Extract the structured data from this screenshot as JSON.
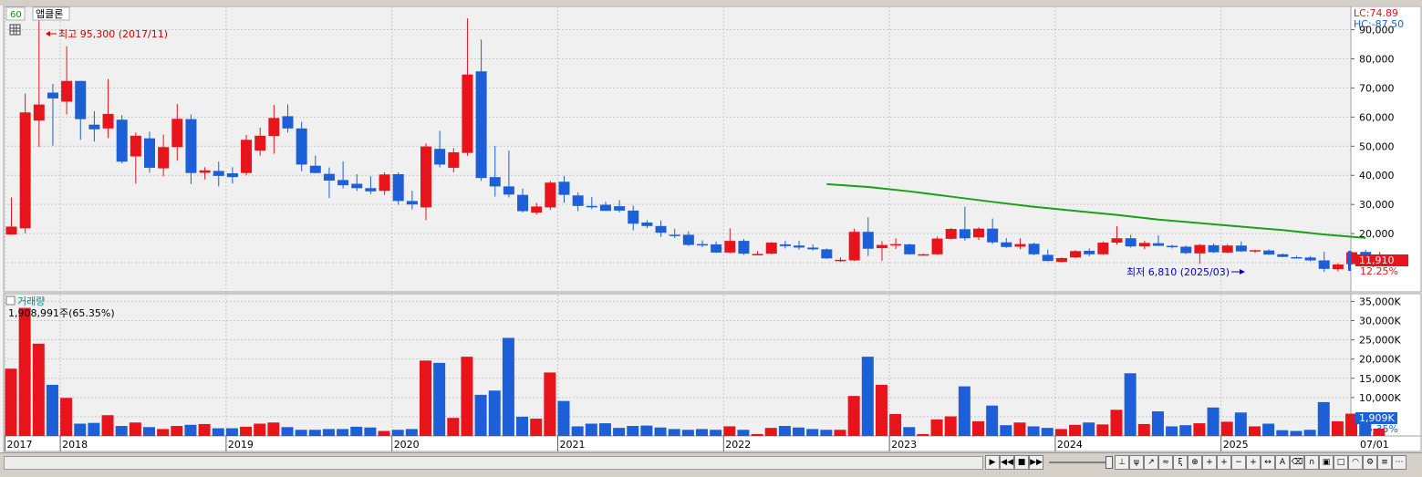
{
  "header": {
    "period_label": "60",
    "stock_name": "앱클론"
  },
  "price_panel": {
    "high_annotation": "최고 95,300 (2017/11)",
    "low_annotation": "최저 6,810 (2025/03)",
    "lc_label": "LC:74.89",
    "hc_label": "HC:-87.50",
    "current_price_label": "11,910",
    "current_pct_label": "12.25%",
    "y_ticks": [
      "90,000",
      "80,000",
      "70,000",
      "60,000",
      "50,000",
      "40,000",
      "30,000",
      "20,000",
      "10,000"
    ]
  },
  "volume_panel": {
    "title": "거래량",
    "summary": "1,908,991주(65.35%)",
    "current_volume_label": "1,909K",
    "current_pct_label": "65.35%",
    "y_ticks": [
      "35,000K",
      "30,000K",
      "25,000K",
      "20,000K",
      "15,000K",
      "10,000K",
      "5,000K"
    ]
  },
  "x_axis": {
    "labels": [
      "2017",
      "2018",
      "2019",
      "2020",
      "2021",
      "2022",
      "2023",
      "2024",
      "2025"
    ],
    "right_label": "07/01"
  },
  "colors": {
    "up": "#e8141c",
    "down": "#1c5fd6",
    "ma": "#1aa01a",
    "annotation_red": "#d40000",
    "annotation_blue": "#0000c0"
  },
  "chart_data": {
    "type": "candlestick",
    "period": "monthly",
    "price_ylim": [
      0,
      98000
    ],
    "volume_ylim": [
      0,
      37000
    ],
    "volume_unit": "K",
    "candles": [
      {
        "o": 19700,
        "h": 32400,
        "l": 19700,
        "c": 22400,
        "v": 17500
      },
      {
        "o": 21800,
        "h": 68100,
        "l": 20100,
        "c": 61600,
        "v": 33300
      },
      {
        "o": 58800,
        "h": 95300,
        "l": 49700,
        "c": 64300,
        "v": 24000
      },
      {
        "o": 68400,
        "h": 71400,
        "l": 50200,
        "c": 66400,
        "v": 13300
      },
      {
        "o": 65300,
        "h": 84300,
        "l": 60900,
        "c": 72400,
        "v": 9900
      },
      {
        "o": 72400,
        "h": 72400,
        "l": 52200,
        "c": 59300,
        "v": 3200
      },
      {
        "o": 57400,
        "h": 62000,
        "l": 51600,
        "c": 55800,
        "v": 3400
      },
      {
        "o": 56100,
        "h": 73100,
        "l": 52800,
        "c": 61100,
        "v": 5400
      },
      {
        "o": 59100,
        "h": 60700,
        "l": 44100,
        "c": 44700,
        "v": 2600
      },
      {
        "o": 46500,
        "h": 54700,
        "l": 37100,
        "c": 53600,
        "v": 3500
      },
      {
        "o": 52700,
        "h": 55000,
        "l": 40900,
        "c": 42600,
        "v": 2300
      },
      {
        "o": 42400,
        "h": 54000,
        "l": 39600,
        "c": 49700,
        "v": 1800
      },
      {
        "o": 49700,
        "h": 64500,
        "l": 45000,
        "c": 59400,
        "v": 2600
      },
      {
        "o": 59300,
        "h": 60900,
        "l": 37000,
        "c": 40800,
        "v": 2900
      },
      {
        "o": 40900,
        "h": 42800,
        "l": 38600,
        "c": 41700,
        "v": 3100
      },
      {
        "o": 41500,
        "h": 44700,
        "l": 36200,
        "c": 39800,
        "v": 2000
      },
      {
        "o": 40700,
        "h": 42800,
        "l": 37200,
        "c": 39400,
        "v": 2000
      },
      {
        "o": 40800,
        "h": 53900,
        "l": 40000,
        "c": 52200,
        "v": 2400
      },
      {
        "o": 48500,
        "h": 56400,
        "l": 46700,
        "c": 53600,
        "v": 3200
      },
      {
        "o": 53500,
        "h": 64200,
        "l": 47400,
        "c": 59700,
        "v": 3500
      },
      {
        "o": 60300,
        "h": 64400,
        "l": 54700,
        "c": 56100,
        "v": 2300
      },
      {
        "o": 56100,
        "h": 58400,
        "l": 41400,
        "c": 43700,
        "v": 1600
      },
      {
        "o": 43300,
        "h": 46800,
        "l": 40700,
        "c": 40800,
        "v": 1600
      },
      {
        "o": 40500,
        "h": 42700,
        "l": 32200,
        "c": 38200,
        "v": 1800
      },
      {
        "o": 38400,
        "h": 44800,
        "l": 35500,
        "c": 36600,
        "v": 1800
      },
      {
        "o": 37100,
        "h": 40400,
        "l": 34600,
        "c": 35600,
        "v": 2400
      },
      {
        "o": 35600,
        "h": 39700,
        "l": 33600,
        "c": 34500,
        "v": 2200
      },
      {
        "o": 34700,
        "h": 41000,
        "l": 33300,
        "c": 40300,
        "v": 1300
      },
      {
        "o": 40400,
        "h": 41000,
        "l": 29900,
        "c": 31200,
        "v": 1600
      },
      {
        "o": 31200,
        "h": 34700,
        "l": 28300,
        "c": 30000,
        "v": 1800
      },
      {
        "o": 29000,
        "h": 51000,
        "l": 24600,
        "c": 49900,
        "v": 19600
      },
      {
        "o": 49100,
        "h": 55300,
        "l": 42700,
        "c": 43700,
        "v": 19000
      },
      {
        "o": 42600,
        "h": 49300,
        "l": 41000,
        "c": 47900,
        "v": 4700
      },
      {
        "o": 47700,
        "h": 93900,
        "l": 46700,
        "c": 74600,
        "v": 20600
      },
      {
        "o": 75700,
        "h": 86600,
        "l": 38100,
        "c": 39100,
        "v": 10700
      },
      {
        "o": 39400,
        "h": 50100,
        "l": 32700,
        "c": 36200,
        "v": 11800
      },
      {
        "o": 36200,
        "h": 48500,
        "l": 32400,
        "c": 33400,
        "v": 25500
      },
      {
        "o": 33300,
        "h": 35400,
        "l": 27300,
        "c": 27700,
        "v": 5000
      },
      {
        "o": 27200,
        "h": 30600,
        "l": 26500,
        "c": 29300,
        "v": 4500
      },
      {
        "o": 29000,
        "h": 38100,
        "l": 28100,
        "c": 37500,
        "v": 16500
      },
      {
        "o": 37800,
        "h": 39800,
        "l": 30600,
        "c": 33300,
        "v": 9100
      },
      {
        "o": 33100,
        "h": 34100,
        "l": 27700,
        "c": 29500,
        "v": 2500
      },
      {
        "o": 29500,
        "h": 32600,
        "l": 28400,
        "c": 29400,
        "v": 3200
      },
      {
        "o": 29900,
        "h": 30900,
        "l": 28100,
        "c": 27800,
        "v": 3300
      },
      {
        "o": 29400,
        "h": 31500,
        "l": 27300,
        "c": 27900,
        "v": 2100
      },
      {
        "o": 27900,
        "h": 29600,
        "l": 21100,
        "c": 23400,
        "v": 2600
      },
      {
        "o": 23800,
        "h": 24600,
        "l": 21900,
        "c": 22600,
        "v": 2700
      },
      {
        "o": 22600,
        "h": 24500,
        "l": 18900,
        "c": 20300,
        "v": 2200
      },
      {
        "o": 19600,
        "h": 21700,
        "l": 18500,
        "c": 19400,
        "v": 1800
      },
      {
        "o": 19600,
        "h": 20800,
        "l": 15800,
        "c": 16100,
        "v": 1600
      },
      {
        "o": 16400,
        "h": 17700,
        "l": 15400,
        "c": 16200,
        "v": 1800
      },
      {
        "o": 16300,
        "h": 17300,
        "l": 13400,
        "c": 13500,
        "v": 1600
      },
      {
        "o": 13500,
        "h": 21800,
        "l": 13200,
        "c": 17500,
        "v": 2500
      },
      {
        "o": 17500,
        "h": 18200,
        "l": 12700,
        "c": 13100,
        "v": 1600
      },
      {
        "o": 13000,
        "h": 14000,
        "l": 12600,
        "c": 13000,
        "v": 500
      },
      {
        "o": 13100,
        "h": 17100,
        "l": 12900,
        "c": 16900,
        "v": 2100
      },
      {
        "o": 16300,
        "h": 17500,
        "l": 14900,
        "c": 15700,
        "v": 2600
      },
      {
        "o": 15900,
        "h": 17500,
        "l": 14500,
        "c": 15200,
        "v": 2200
      },
      {
        "o": 15200,
        "h": 16300,
        "l": 14200,
        "c": 14600,
        "v": 1800
      },
      {
        "o": 14600,
        "h": 14900,
        "l": 11300,
        "c": 11500,
        "v": 1600
      },
      {
        "o": 11000,
        "h": 11800,
        "l": 10300,
        "c": 11000,
        "v": 1600
      },
      {
        "o": 10800,
        "h": 21700,
        "l": 10600,
        "c": 20600,
        "v": 10400
      },
      {
        "o": 20600,
        "h": 25600,
        "l": 12300,
        "c": 14800,
        "v": 20600
      },
      {
        "o": 15000,
        "h": 17400,
        "l": 10700,
        "c": 16100,
        "v": 13300
      },
      {
        "o": 16100,
        "h": 18400,
        "l": 14700,
        "c": 16400,
        "v": 5700
      },
      {
        "o": 16300,
        "h": 16500,
        "l": 12800,
        "c": 12900,
        "v": 2300
      },
      {
        "o": 12800,
        "h": 13100,
        "l": 12500,
        "c": 12900,
        "v": 500
      },
      {
        "o": 12900,
        "h": 19000,
        "l": 12700,
        "c": 18300,
        "v": 4300
      },
      {
        "o": 18200,
        "h": 21900,
        "l": 17900,
        "c": 21600,
        "v": 5100
      },
      {
        "o": 21500,
        "h": 29200,
        "l": 17600,
        "c": 18400,
        "v": 12900
      },
      {
        "o": 18700,
        "h": 22200,
        "l": 17800,
        "c": 21700,
        "v": 3800
      },
      {
        "o": 21700,
        "h": 25200,
        "l": 16400,
        "c": 17000,
        "v": 7900
      },
      {
        "o": 17000,
        "h": 18500,
        "l": 15100,
        "c": 15400,
        "v": 2800
      },
      {
        "o": 15500,
        "h": 18400,
        "l": 14700,
        "c": 16400,
        "v": 3500
      },
      {
        "o": 16500,
        "h": 16900,
        "l": 12600,
        "c": 12900,
        "v": 2500
      },
      {
        "o": 12700,
        "h": 14500,
        "l": 10400,
        "c": 10600,
        "v": 2100
      },
      {
        "o": 10300,
        "h": 11800,
        "l": 10100,
        "c": 11600,
        "v": 1800
      },
      {
        "o": 11800,
        "h": 14300,
        "l": 11600,
        "c": 14000,
        "v": 2900
      },
      {
        "o": 14100,
        "h": 14900,
        "l": 12200,
        "c": 12900,
        "v": 3500
      },
      {
        "o": 12900,
        "h": 17300,
        "l": 12700,
        "c": 16900,
        "v": 3000
      },
      {
        "o": 16900,
        "h": 22600,
        "l": 16200,
        "c": 18400,
        "v": 6800
      },
      {
        "o": 18400,
        "h": 19600,
        "l": 15200,
        "c": 15600,
        "v": 16300
      },
      {
        "o": 15600,
        "h": 17500,
        "l": 14600,
        "c": 16800,
        "v": 3100
      },
      {
        "o": 16700,
        "h": 19400,
        "l": 15700,
        "c": 15800,
        "v": 6400
      },
      {
        "o": 15800,
        "h": 16200,
        "l": 14900,
        "c": 15600,
        "v": 2500
      },
      {
        "o": 15500,
        "h": 15900,
        "l": 13000,
        "c": 13300,
        "v": 2800
      },
      {
        "o": 13200,
        "h": 16400,
        "l": 9700,
        "c": 16100,
        "v": 3300
      },
      {
        "o": 16000,
        "h": 16600,
        "l": 13300,
        "c": 13600,
        "v": 7400
      },
      {
        "o": 13500,
        "h": 16400,
        "l": 13300,
        "c": 15900,
        "v": 3700
      },
      {
        "o": 15900,
        "h": 17300,
        "l": 13700,
        "c": 13900,
        "v": 6100
      },
      {
        "o": 13900,
        "h": 14400,
        "l": 13300,
        "c": 14300,
        "v": 2500
      },
      {
        "o": 14200,
        "h": 14600,
        "l": 12700,
        "c": 12800,
        "v": 3200
      },
      {
        "o": 12900,
        "h": 13200,
        "l": 11900,
        "c": 12000,
        "v": 1500
      },
      {
        "o": 11900,
        "h": 12400,
        "l": 11600,
        "c": 11800,
        "v": 1300
      },
      {
        "o": 11800,
        "h": 12300,
        "l": 10500,
        "c": 10800,
        "v": 1600
      },
      {
        "o": 10800,
        "h": 13800,
        "l": 6810,
        "c": 7900,
        "v": 8800
      },
      {
        "o": 7800,
        "h": 9900,
        "l": 7000,
        "c": 9400,
        "v": 3800
      },
      {
        "o": 9500,
        "h": 13900,
        "l": 9300,
        "c": 13600,
        "v": 5800
      },
      {
        "o": 13700,
        "h": 14500,
        "l": 10700,
        "c": 11100,
        "v": 3500
      },
      {
        "o": 11300,
        "h": 13700,
        "l": 10500,
        "c": 11910,
        "v": 1909
      }
    ],
    "moving_average": [
      {
        "i": 59,
        "v": 37000
      },
      {
        "i": 62,
        "v": 36000
      },
      {
        "i": 65,
        "v": 34500
      },
      {
        "i": 68,
        "v": 32700
      },
      {
        "i": 71,
        "v": 30900
      },
      {
        "i": 74,
        "v": 29200
      },
      {
        "i": 77,
        "v": 27800
      },
      {
        "i": 80,
        "v": 26400
      },
      {
        "i": 83,
        "v": 24800
      },
      {
        "i": 86,
        "v": 23600
      },
      {
        "i": 89,
        "v": 22400
      },
      {
        "i": 92,
        "v": 21200
      },
      {
        "i": 95,
        "v": 19700
      },
      {
        "i": 98,
        "v": 18500
      }
    ]
  }
}
